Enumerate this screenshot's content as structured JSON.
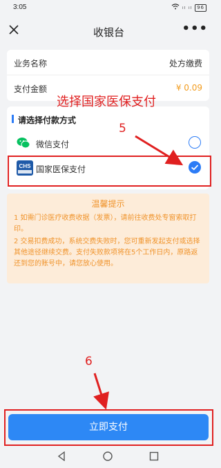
{
  "status_bar": {
    "time": "3:05",
    "signal": "ᵢₗ ᵢₗ",
    "battery": "96"
  },
  "nav": {
    "title": "收银台",
    "more": "•••"
  },
  "info": {
    "business_label": "业务名称",
    "business_value": "处方缴费",
    "amount_label": "支付金额",
    "amount_value": "¥ 0.09"
  },
  "payment": {
    "title": "请选择付款方式",
    "options": [
      {
        "label": "微信支付",
        "selected": false
      },
      {
        "label": "国家医保支付",
        "selected": true
      }
    ],
    "chs_logo_text": "CHS"
  },
  "notice": {
    "title": "温馨提示",
    "items": [
      "1 如需门诊医疗收费收据（发票），请前往收费处专窗索取打印。",
      "2 交易扣费成功，系统交费失败时，您可重新发起支付或选择其他途径继续交费。支付失败款项将在5个工作日内，原路返还到您的账号中，请您放心使用。"
    ]
  },
  "annotations": {
    "select_text": "选择国家医保支付",
    "step5": "5",
    "step6": "6"
  },
  "pay_button": "立即支付",
  "colors": {
    "accent": "#2c7cf6",
    "annotation": "#e02020",
    "notice_text": "#f0932b",
    "wechat": "#07c160"
  }
}
